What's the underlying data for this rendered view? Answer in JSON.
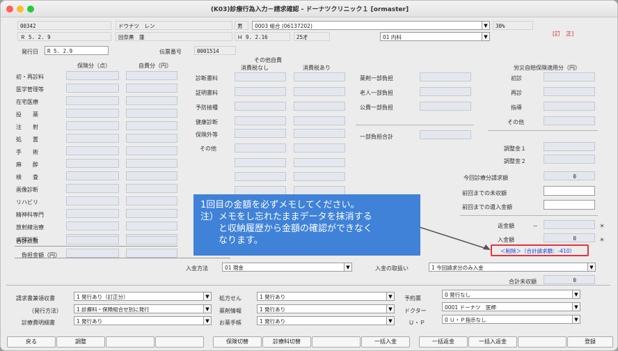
{
  "window": {
    "title": "(K03)診療行為入力－請求確認 - ドーナツクリニック１ [ormaster]",
    "traffic_colors": [
      "#fe5f57",
      "#febc2e",
      "#28c840"
    ]
  },
  "patient": {
    "id": "00342",
    "name_kana": "ドウナツ　レン",
    "sex": "男",
    "insurance": "0003 組合 (06137202)",
    "ratio": "30%",
    "visit_date": "Ｒ 5. 2. 9",
    "name": "回奈黒　蓮",
    "birth": "Ｈ 9. 2.16",
    "age": "25才",
    "department": "01 内科",
    "correction": "[訂　正]"
  },
  "issue": {
    "date_label": "発行日",
    "date_value": "R 5. 2.9",
    "slip_label": "伝票番号",
    "slip_value": "0001514"
  },
  "headers": {
    "insured": "保険分（点）",
    "self": "自費分（円）",
    "other_self": "その他自費",
    "tax_none": "消費税なし",
    "tax_yes": "消費税あり",
    "rosai": "労災自賠保険適用分（円）"
  },
  "left_rows": [
    "初・再診料",
    "医学管理等",
    "在宅医療",
    "投　　薬",
    "注　　射",
    "処　　置",
    "手　　術",
    "麻　　酔",
    "検　　査",
    "画像診断",
    "リハビリ",
    "精神科専門",
    "放射線治療",
    "病理診断"
  ],
  "total_points": "合計点数",
  "burden_amount": "負担金額（円）",
  "mid_rows": [
    "診断書料",
    "証明書料",
    "予防接種",
    "健康診断",
    "保険外等",
    "その他"
  ],
  "public_rows": [
    "薬剤一部負担",
    "老人一部負担",
    "公費一部負担"
  ],
  "partial_total": "一部負担合計",
  "rosai_rows": [
    "初診",
    "再診",
    "指導",
    "その他"
  ],
  "adjust": [
    "調整金１",
    "調整金２"
  ],
  "summary": {
    "current_label": "今回診療分請求額",
    "current_value": "0",
    "prev_unpaid_label": "前回までの未収額",
    "prev_refund_label": "前回までの還入金額",
    "refund_label": "返金額",
    "refund_sign": "－",
    "received_label": "入金額",
    "received_value": "0",
    "asterisk": "＊",
    "delete_link": "＜削除＞（合計請求額：-410）",
    "unpaid_total_label": "合計未収額",
    "unpaid_total_value": "0"
  },
  "payment": {
    "method_label": "入金方法",
    "method_value": "01 現金",
    "handling_label": "入金の取扱い",
    "handling_value": "1 今回請求分のみ入金"
  },
  "issue_forms": {
    "receipt_label": "請求書兼領収書",
    "receipt_value": "1 発行あり（訂正分）",
    "method_label": "（発行方法）",
    "method_value": "1 診療科・保険組合せ別に発行",
    "detail_label": "診療費明細書",
    "detail_value": "1 発行あり",
    "rx_label": "処方せん",
    "rx_value": "1 発行あり",
    "drug_label": "薬剤情報",
    "drug_value": "1 発行あり",
    "notebook_label": "お薬手帳",
    "notebook_value": "1 発行あり",
    "appt_label": "予約票",
    "appt_value": "0 発行なし",
    "doctor_label": "ドクター",
    "doctor_value": "0001 ドーナツ　医師",
    "up_label": "Ｕ・Ｐ",
    "up_value": "0 Ｕ・Ｐ指示なし"
  },
  "buttons": {
    "back": "戻る",
    "adjust": "調整",
    "ins_switch": "保険切替",
    "dept_switch": "診療科切替",
    "bulk_in": "一括入金",
    "bulk_refund": "一括返金",
    "bulk_in_refund": "一括入返金",
    "register": "登録"
  },
  "tooltip": "1回目の金額を必ずメモしてください。\n注）メモをし忘れたままデータを抹消する\n　　と収納履歴から金額の確認ができなく\n　　なります。"
}
